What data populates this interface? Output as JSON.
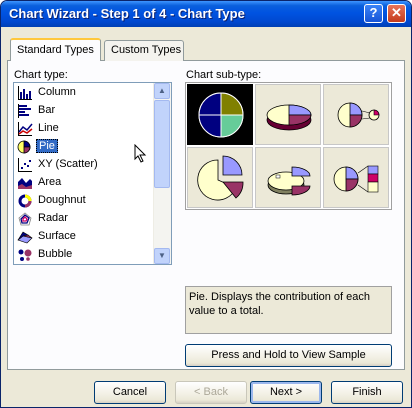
{
  "window": {
    "title": "Chart Wizard - Step 1 of 4 - Chart Type"
  },
  "titlebar_buttons": {
    "help": "?",
    "close": "✕"
  },
  "tabs": [
    {
      "label": "Standard Types"
    },
    {
      "label": "Custom Types"
    }
  ],
  "chart_type_label": "Chart type:",
  "chart_types": [
    {
      "label": "Column",
      "icon": "column-chart-icon"
    },
    {
      "label": "Bar",
      "icon": "bar-chart-icon"
    },
    {
      "label": "Line",
      "icon": "line-chart-icon"
    },
    {
      "label": "Pie",
      "icon": "pie-chart-icon",
      "selected": true
    },
    {
      "label": "XY (Scatter)",
      "icon": "scatter-chart-icon"
    },
    {
      "label": "Area",
      "icon": "area-chart-icon"
    },
    {
      "label": "Doughnut",
      "icon": "doughnut-chart-icon"
    },
    {
      "label": "Radar",
      "icon": "radar-chart-icon"
    },
    {
      "label": "Surface",
      "icon": "surface-chart-icon"
    },
    {
      "label": "Bubble",
      "icon": "bubble-chart-icon"
    }
  ],
  "sub_type_label": "Chart sub-type:",
  "description": "Pie. Displays the contribution of each value to a total.",
  "sample_button": "Press and Hold to View Sample",
  "buttons": {
    "cancel": "Cancel",
    "back": "< Back",
    "next": "Next >",
    "finish": "Finish"
  },
  "colors": {
    "title_bar": "#0053e1",
    "selection": "#316ac5",
    "pie_purple": "#9999ff",
    "pie_maroon": "#993366",
    "pie_cream": "#ffffcc",
    "pie_teal": "#66cc99"
  }
}
